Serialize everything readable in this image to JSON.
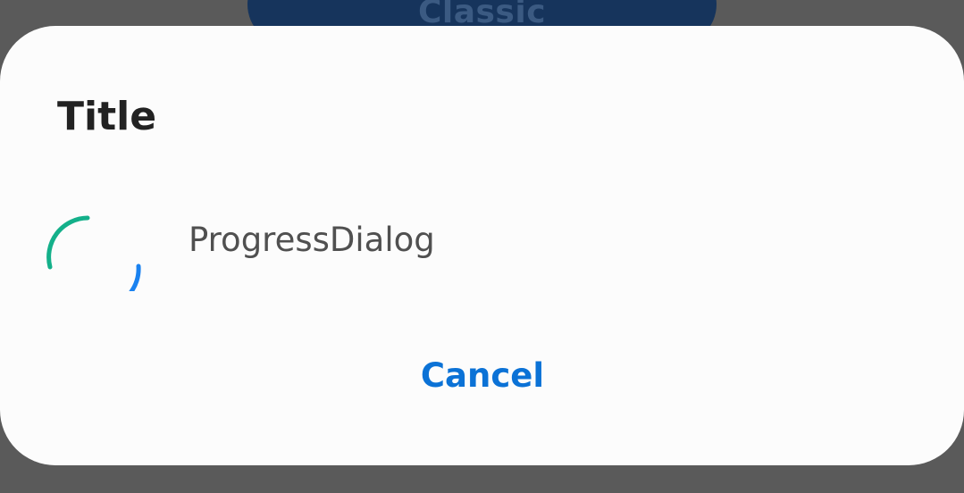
{
  "background": {
    "button_label": "Classic",
    "button_color": "#16345c"
  },
  "dialog": {
    "title": "Title",
    "message": "ProgressDialog",
    "cancel_label": "Cancel",
    "spinner": {
      "icon": "circular-progress-spinner",
      "colors": [
        "#14b08a",
        "#1a82f0"
      ]
    },
    "accent_color": "#0b72d6"
  }
}
